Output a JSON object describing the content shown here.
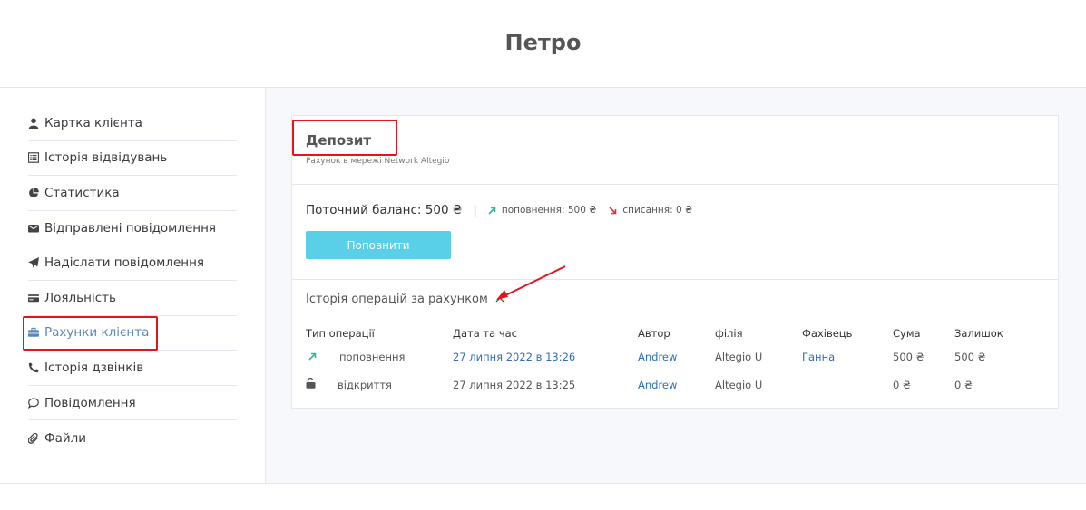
{
  "page_title": "Петро",
  "sidebar": {
    "items": [
      {
        "label": "Картка клієнта",
        "icon": "user-icon"
      },
      {
        "label": "Історія відвідувань",
        "icon": "list-icon"
      },
      {
        "label": "Статистика",
        "icon": "pie-chart-icon"
      },
      {
        "label": "Відправлені повідомлення",
        "icon": "envelope-icon"
      },
      {
        "label": "Надіслати повідомлення",
        "icon": "paper-plane-icon"
      },
      {
        "label": "Лояльність",
        "icon": "card-icon"
      },
      {
        "label": "Рахунки клієнта",
        "icon": "briefcase-icon"
      },
      {
        "label": "Історія дзвінків",
        "icon": "phone-icon"
      },
      {
        "label": "Повідомлення",
        "icon": "chat-bubble-icon"
      },
      {
        "label": "Файли",
        "icon": "paperclip-icon"
      }
    ],
    "active_index": 6
  },
  "deposit": {
    "title": "Депозит",
    "subtitle": "Рахунок в мережі Network Altegio",
    "balance_label": "Поточний баланс: 500 ₴",
    "separator": "|",
    "topup_text": "поповнення: 500 ₴",
    "writeoff_text": "списання: 0 ₴",
    "topup_button": "Поповнити"
  },
  "history": {
    "title": "Історія операцій за рахунком",
    "columns": [
      "Тип операції",
      "Дата та час",
      "Автор",
      "філія",
      "Фахівець",
      "Сума",
      "Залишок"
    ],
    "rows": [
      {
        "icon": "arrow-up-right-icon",
        "type": "поповнення",
        "datetime": "27 липня 2022 в 13:26",
        "author": "Andrew",
        "branch": "Altegio U",
        "specialist": "Ганна",
        "amount": "500 ₴",
        "balance": "500 ₴"
      },
      {
        "icon": "unlock-icon",
        "type": "відкриття",
        "datetime": "27 липня 2022 в 13:25",
        "author": "Andrew",
        "branch": "Altegio U",
        "specialist": "",
        "amount": "0 ₴",
        "balance": "0 ₴"
      }
    ]
  },
  "colors": {
    "accent_button": "#59cfe8",
    "link": "#2f6fb0",
    "active_nav": "#5b87b8",
    "annotation_red": "#e3141b",
    "topup_arrow": "#2bb9a0",
    "writeoff_arrow": "#e0303a"
  }
}
